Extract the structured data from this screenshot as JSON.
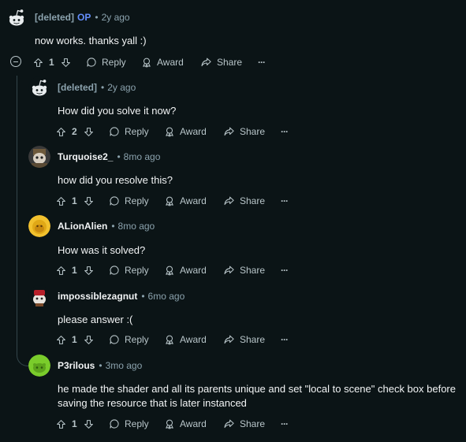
{
  "comments": [
    {
      "author": "[deleted]",
      "op": "OP",
      "sep": "•",
      "time": "2y ago",
      "body": "now works. thanks yall :)",
      "votes": "1",
      "avatar": "deleted"
    },
    {
      "author": "[deleted]",
      "op": "",
      "sep": "•",
      "time": "2y ago",
      "body": "How did you solve it now?",
      "votes": "2",
      "avatar": "deleted"
    },
    {
      "author": "Turquoise2_",
      "op": "",
      "sep": "•",
      "time": "8mo ago",
      "body": "how did you resolve this?",
      "votes": "1",
      "avatar": "turquoise"
    },
    {
      "author": "ALionAlien",
      "op": "",
      "sep": "•",
      "time": "8mo ago",
      "body": "How was it solved?",
      "votes": "1",
      "avatar": "lion"
    },
    {
      "author": "impossiblezagnut",
      "op": "",
      "sep": "•",
      "time": "6mo ago",
      "body": "please answer :(",
      "votes": "1",
      "avatar": "zagnut"
    },
    {
      "author": "P3rilous",
      "op": "",
      "sep": "•",
      "time": "3mo ago",
      "body": "he made the shader and all its parents unique and set \"local to scene\" check box before saving the resource that is later instanced",
      "votes": "1",
      "avatar": "perilous"
    }
  ],
  "actions": {
    "reply": "Reply",
    "award": "Award",
    "share": "Share",
    "more": "···"
  },
  "icons": {
    "upvote": "upvote-icon",
    "downvote": "downvote-icon",
    "reply": "reply-bubble-icon",
    "award": "award-icon",
    "share": "share-icon",
    "more": "more-icon",
    "collapse": "collapse-icon"
  },
  "colors": {
    "background": "#0b1416",
    "op": "#648efc",
    "meta": "#8ba2ad",
    "text": "#f2f4f5",
    "thread_line": "#33464c"
  }
}
